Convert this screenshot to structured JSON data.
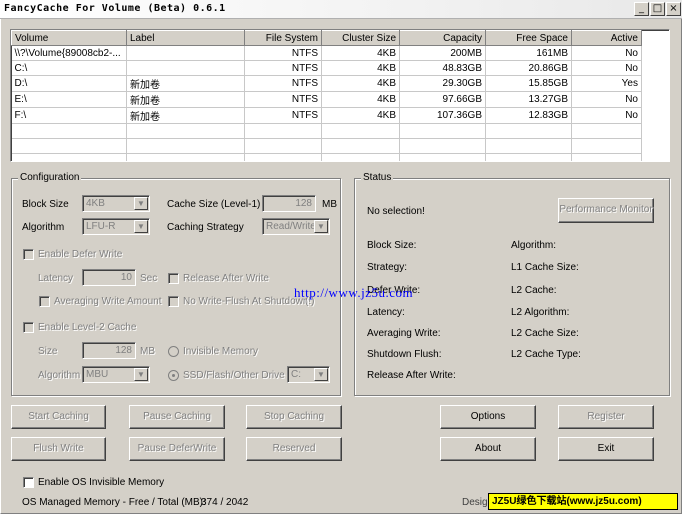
{
  "window": {
    "title": "FancyCache For Volume (Beta) 0.6.1",
    "minimize": "_",
    "maximize": "□",
    "close": "×"
  },
  "volumes": {
    "columns": [
      "Volume",
      "Label",
      "File System",
      "Cluster Size",
      "Capacity",
      "Free Space",
      "Active"
    ],
    "rows": [
      [
        "\\\\?\\Volume{89008cb2-...",
        "",
        "NTFS",
        "4KB",
        "200MB",
        "161MB",
        "No"
      ],
      [
        "C:\\",
        "",
        "NTFS",
        "4KB",
        "48.83GB",
        "20.86GB",
        "No"
      ],
      [
        "D:\\",
        "新加卷",
        "NTFS",
        "4KB",
        "29.30GB",
        "15.85GB",
        "Yes"
      ],
      [
        "E:\\",
        "新加卷",
        "NTFS",
        "4KB",
        "97.66GB",
        "13.27GB",
        "No"
      ],
      [
        "F:\\",
        "新加卷",
        "NTFS",
        "4KB",
        "107.36GB",
        "12.83GB",
        "No"
      ]
    ]
  },
  "config": {
    "title": "Configuration",
    "block_size_label": "Block Size",
    "block_size_value": "4KB",
    "cache_size_label": "Cache Size (Level-1)",
    "cache_size_value": "128",
    "cache_size_unit": "MB",
    "algorithm_label": "Algorithm",
    "algorithm_value": "LFU-R",
    "strategy_label": "Caching Strategy",
    "strategy_value": "Read/Write",
    "defer_write_label": "Enable Defer Write",
    "latency_label": "Latency",
    "latency_value": "10",
    "latency_unit": "Sec",
    "release_after_write_label": "Release After Write",
    "averaging_write_label": "Averaging Write Amount",
    "no_write_flush_label": "No Write-Flush At Shutdown",
    "no_write_flush_hint": "(!)",
    "level2_label": "Enable Level-2 Cache",
    "size_label": "Size",
    "size_value": "128",
    "size_unit": "MB",
    "invisible_memory_label": "Invisible Memory",
    "l2_algorithm_label": "Algorithm",
    "l2_algorithm_value": "MBU",
    "ssd_label": "SSD/Flash/Other Drive",
    "drive_value": "C:"
  },
  "status": {
    "title": "Status",
    "selection_text": "No selection!",
    "perf_monitor": "Performance Monitor",
    "block_size": "Block Size:",
    "algorithm": "Algorithm:",
    "strategy": "Strategy:",
    "l1_cache_size": "L1 Cache Size:",
    "defer_write": "Defer Write:",
    "l2_cache": "L2 Cache:",
    "latency": "Latency:",
    "l2_algorithm": "L2 Algorithm:",
    "averaging_write": "Averaging Write:",
    "l2_cache_size": "L2 Cache Size:",
    "shutdown_flush": "Shutdown Flush:",
    "l2_cache_type": "L2 Cache Type:",
    "release_after_write": "Release After Write:"
  },
  "buttons": {
    "start_caching": "Start Caching",
    "pause_caching": "Pause Caching",
    "stop_caching": "Stop Caching",
    "options": "Options",
    "register": "Register",
    "flush_write": "Flush Write",
    "pause_defer_write": "Pause DeferWrite",
    "reserved": "Reserved",
    "about": "About",
    "exit": "Exit"
  },
  "footer": {
    "os_invisible_memory": "Enable OS Invisible Memory",
    "os_memory_label": "OS Managed Memory - Free / Total (MB):",
    "os_memory_value": "374 / 2042",
    "design_text": "Desig"
  },
  "watermark": {
    "url": "http://www.jz5u.com",
    "badge": "JZ5U绿色下载站(www.jz5u.com)"
  }
}
